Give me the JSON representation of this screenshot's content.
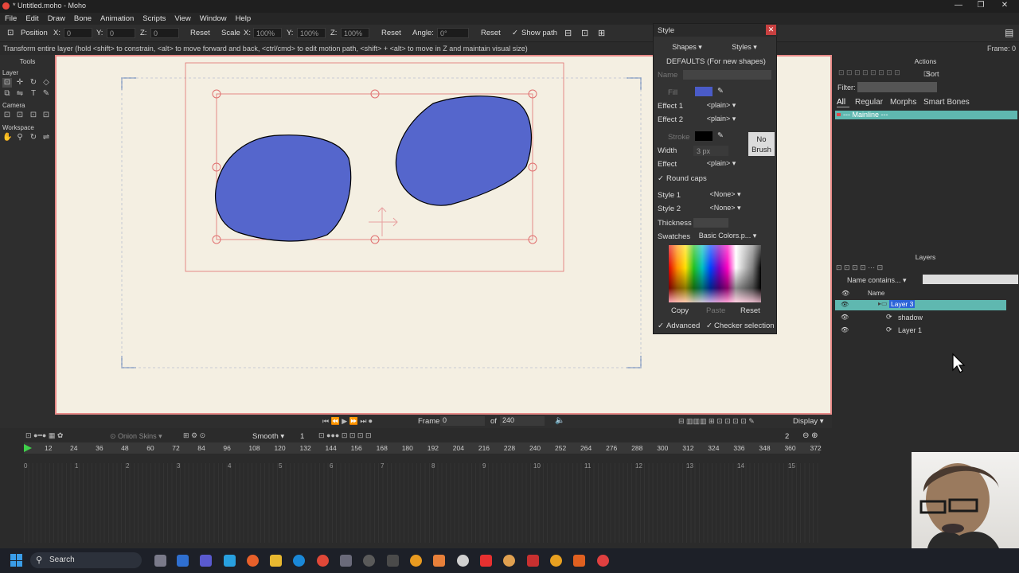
{
  "window": {
    "title": "* Untitled.moho - Moho",
    "minimize": "—",
    "maximize": "❐",
    "close": "✕"
  },
  "menu": [
    "File",
    "Edit",
    "Draw",
    "Bone",
    "Animation",
    "Scripts",
    "View",
    "Window",
    "Help"
  ],
  "toolbar": {
    "position_label": "Position",
    "x_label": "X:",
    "x_value": "0",
    "y_label": "Y:",
    "y_value": "0",
    "z_label": "Z:",
    "z_value": "0",
    "reset1": "Reset",
    "scale_label": "Scale",
    "sx_label": "X:",
    "sx_value": "100%",
    "sy_label": "Y:",
    "sy_value": "100%",
    "sz_label": "Z:",
    "sz_value": "100%",
    "reset2": "Reset",
    "angle_label": "Angle:",
    "angle_value": "0°",
    "reset3": "Reset",
    "show_path": "Show path"
  },
  "status": {
    "message": "Transform entire layer (hold <shift> to constrain, <alt> to move forward and back, <ctrl/cmd> to edit motion path, <shift> + <alt> to move in Z and maintain visual size)",
    "frame": "Frame: 0"
  },
  "tools": {
    "header": "Tools",
    "layer": "Layer",
    "camera": "Camera",
    "workspace": "Workspace"
  },
  "style": {
    "title": "Style",
    "tab_shapes": "Shapes",
    "tab_styles": "Styles",
    "defaults": "DEFAULTS (For new shapes)",
    "name_label": "Name",
    "fill_label": "Fill",
    "fill_color": "#4a5bc8",
    "effect1_label": "Effect 1",
    "effect1_value": "<plain>",
    "effect2_label": "Effect 2",
    "effect2_value": "<plain>",
    "stroke_label": "Stroke",
    "stroke_color": "#000000",
    "no_brush": "No Brush",
    "width_label": "Width",
    "width_value": "3 px",
    "effect_label": "Effect",
    "effect_value": "<plain>",
    "round_caps": "Round caps",
    "style1_label": "Style 1",
    "style1_value": "<None>",
    "style2_label": "Style 2",
    "style2_value": "<None>",
    "thickness_label": "Thickness",
    "swatches_label": "Swatches",
    "swatches_value": "Basic Colors.p...",
    "copy": "Copy",
    "paste": "Paste",
    "reset": "Reset",
    "advanced": "Advanced",
    "checker": "Checker selection"
  },
  "actions": {
    "title": "Actions",
    "sort": "Sort",
    "filter_label": "Filter:",
    "tabs": [
      "All",
      "Regular",
      "Morphs",
      "Smart Bones"
    ],
    "mainline": "--- Mainline ---"
  },
  "layers": {
    "title": "Layers",
    "filter": "Name contains...",
    "col_name": "Name",
    "items": [
      {
        "name": "Layer 3",
        "selected": true
      },
      {
        "name": "shadow",
        "selected": false
      },
      {
        "name": "Layer 1",
        "selected": false
      }
    ]
  },
  "playback": {
    "frame_label": "Frame",
    "frame_value": "0",
    "of_label": "of",
    "total": "240",
    "display": "Display"
  },
  "timeline": {
    "onion": "Onion Skins",
    "interp": "Smooth",
    "interp_n": "1",
    "zoom_n": "2",
    "ruler": [
      "12",
      "24",
      "36",
      "48",
      "60",
      "72",
      "84",
      "96",
      "108",
      "120",
      "132",
      "144",
      "156",
      "168",
      "180",
      "192",
      "204",
      "216",
      "228",
      "240",
      "252",
      "264",
      "276",
      "288",
      "300",
      "312",
      "324",
      "336",
      "348",
      "360",
      "372"
    ],
    "seconds": [
      "0",
      "1",
      "2",
      "3",
      "4",
      "5",
      "6",
      "7",
      "8",
      "9",
      "10",
      "11",
      "12",
      "13",
      "14",
      "15"
    ]
  },
  "taskbar": {
    "search": "Search"
  },
  "colors": {
    "shape_fill": "#5566cc",
    "canvas_bg": "#f4efe2",
    "selection": "#e07070",
    "layer_highlight": "#5fb8b0"
  }
}
